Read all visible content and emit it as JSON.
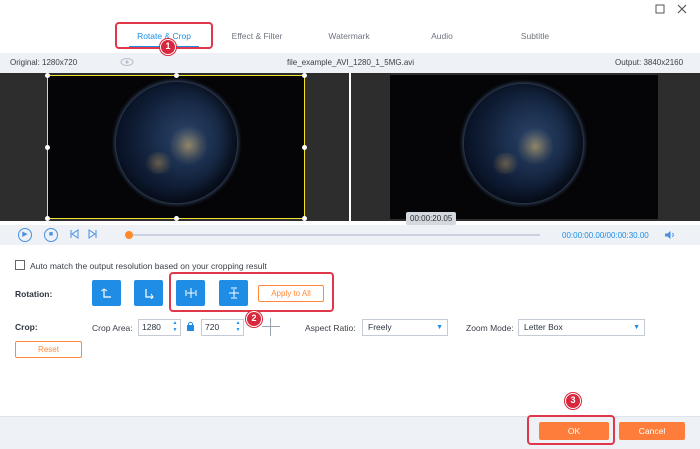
{
  "tabs": [
    {
      "label": "Rotate & Crop",
      "active": true
    },
    {
      "label": "Effect & Filter",
      "active": false
    },
    {
      "label": "Watermark",
      "active": false
    },
    {
      "label": "Audio",
      "active": false
    },
    {
      "label": "Subtitle",
      "active": false
    }
  ],
  "window_controls": {
    "maximize_icon": "maximize-icon",
    "close_icon": "close-icon"
  },
  "info": {
    "original": "Original: 1280x720",
    "filename": "file_example_AVI_1280_1_5MG.avi",
    "output": "Output: 3840x2160"
  },
  "preview": {
    "tooltip_time": "00:00:20.05"
  },
  "playback": {
    "current_time": "00:00:00.00",
    "total_time": "/00:00:30.00",
    "progress": 0.0
  },
  "options": {
    "auto_match_label": "Auto match the output resolution based on your cropping result",
    "auto_match_checked": false,
    "rotation_label": "Rotation:",
    "apply_to_all": "Apply to All",
    "crop_label": "Crop:",
    "crop_area_label": "Crop Area:",
    "crop_width": "1280",
    "crop_height": "720",
    "aspect_ratio_label": "Aspect Ratio:",
    "aspect_ratio_value": "Freely",
    "zoom_mode_label": "Zoom Mode:",
    "zoom_mode_value": "Letter Box",
    "reset": "Reset"
  },
  "footer": {
    "ok": "OK",
    "cancel": "Cancel"
  },
  "annotations": {
    "marker1": "1",
    "marker2": "2",
    "marker3": "3"
  },
  "colors": {
    "accent": "#1f8de6",
    "orange": "#ff7d3b",
    "highlight": "#e1374b",
    "crop_border": "#f3e32a"
  }
}
